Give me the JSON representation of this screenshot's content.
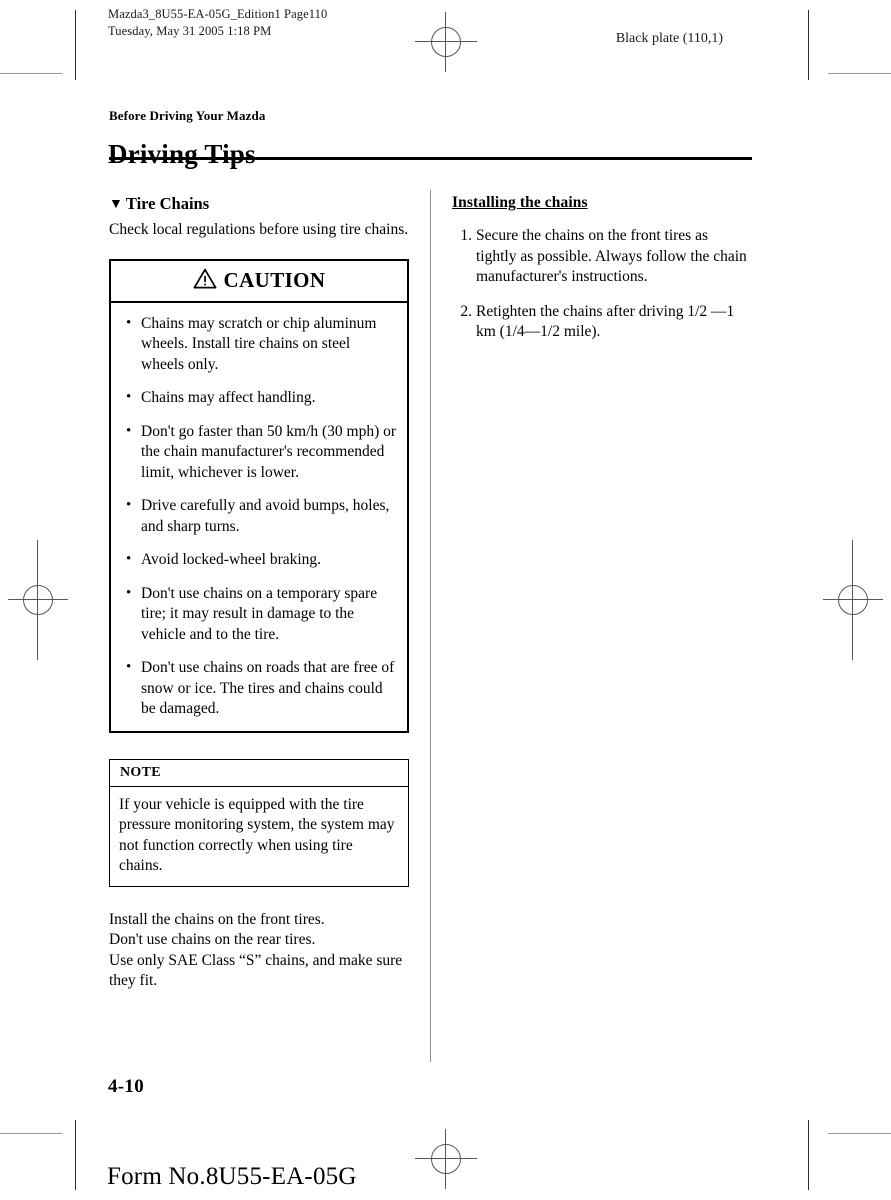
{
  "print_marks": {
    "header_line1": "Mazda3_8U55-EA-05G_Edition1 Page110",
    "header_line2": "Tuesday, May 31 2005 1:18 PM",
    "black_plate": "Black plate (110,1)"
  },
  "chapter": {
    "eyebrow": "Before Driving Your Mazda",
    "title": "Driving Tips"
  },
  "left_column": {
    "topic": {
      "marker": "▼",
      "title": "Tire Chains"
    },
    "intro": "Check local regulations before using tire chains.",
    "caution": {
      "icon": "warning-triangle",
      "label": "CAUTION",
      "items": [
        "Chains may scratch or chip aluminum wheels. Install tire chains on steel wheels only.",
        "Chains may affect handling.",
        "Don't go faster than 50 km/h (30 mph) or the chain manufacturer's recommended limit, whichever is lower.",
        "Drive carefully and avoid bumps, holes, and sharp turns.",
        "Avoid locked-wheel braking.",
        "Don't use chains on a temporary spare tire; it may result in damage to the vehicle and to the tire.",
        "Don't use chains on roads that are free of snow or ice. The tires and chains could be damaged."
      ]
    },
    "note": {
      "label": "NOTE",
      "text": "If your vehicle is equipped with the tire pressure monitoring system, the system may not function correctly when using tire chains."
    },
    "closing": {
      "line1": "Install the chains on the front tires.",
      "line2": "Don't use chains on the rear tires.",
      "line3": "Use only SAE Class “S” chains, and make sure they fit."
    }
  },
  "right_column": {
    "heading": "Installing the chains",
    "steps": [
      {
        "number": "1.",
        "text": "Secure the chains on the front tires as tightly as possible. Always follow the chain manufacturer's instructions."
      },
      {
        "number": "2.",
        "text": "Retighten the chains after driving 1/2 —1 km (1/4—1/2 mile)."
      }
    ]
  },
  "footer": {
    "page_number": "4-10",
    "form_number": "Form No.8U55-EA-05G"
  }
}
